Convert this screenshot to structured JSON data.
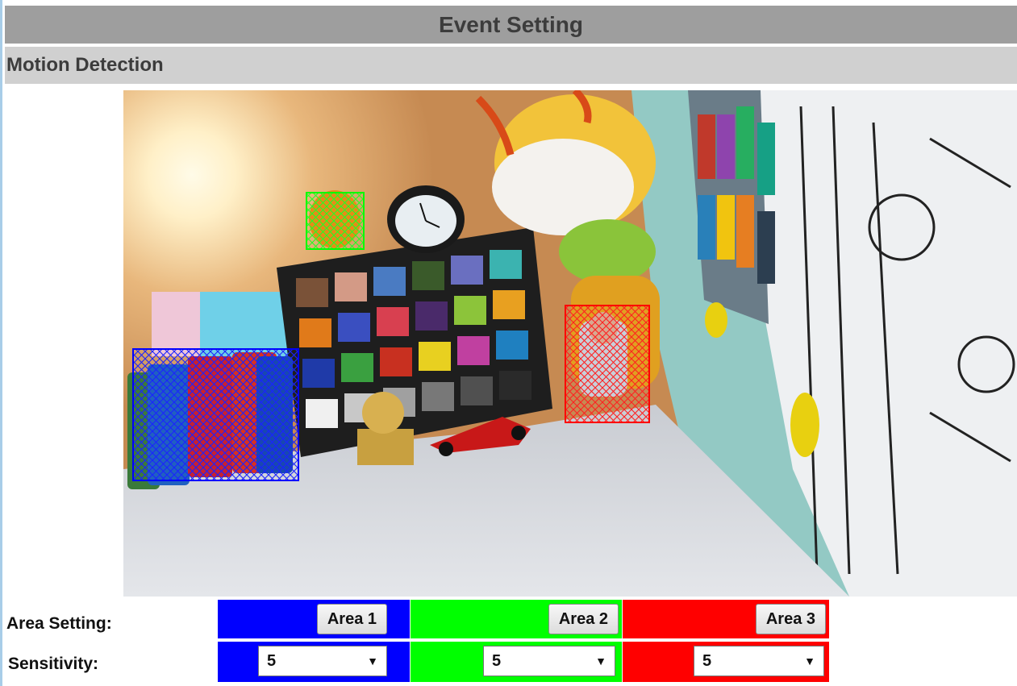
{
  "header": {
    "title": "Event Setting"
  },
  "section": {
    "title": "Motion Detection"
  },
  "preview": {
    "description_icon": "camera-preview",
    "regions": [
      {
        "name": "Area 1",
        "color": "#0000ff"
      },
      {
        "name": "Area 2",
        "color": "#00ff00"
      },
      {
        "name": "Area 3",
        "color": "#ff0000"
      }
    ]
  },
  "area_setting": {
    "label": "Area Setting:",
    "areas": [
      {
        "label": "Area 1",
        "color": "#0000ff"
      },
      {
        "label": "Area 2",
        "color": "#00ff00"
      },
      {
        "label": "Area 3",
        "color": "#ff0000"
      }
    ]
  },
  "sensitivity": {
    "label": "Sensitivity:",
    "values": [
      "5",
      "5",
      "5"
    ]
  },
  "colors": {
    "title_bar": "#9e9e9e",
    "section_bar": "#d0d0d0",
    "accent": "#a8cde8"
  }
}
